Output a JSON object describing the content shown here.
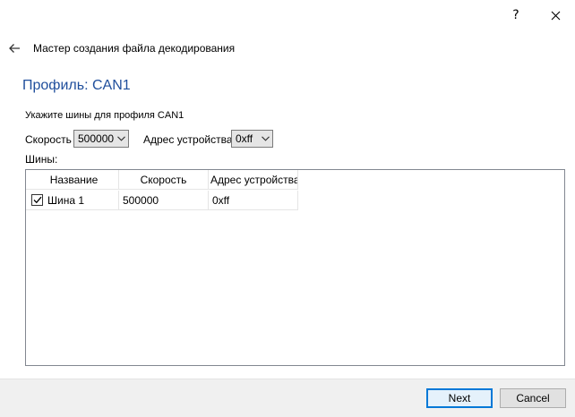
{
  "window": {
    "help_label": "?",
    "close_icon": "close-icon"
  },
  "header": {
    "back_icon": "back-arrow-icon",
    "title": "Мастер создания файла декодирования"
  },
  "page": {
    "title": "Профиль: CAN1",
    "instruction": "Укажите шины для профиля CAN1"
  },
  "form": {
    "speed_label": "Скорость",
    "speed_value": "500000",
    "address_label": "Адрес устройства",
    "address_value": "0xff",
    "buses_label": "Шины:"
  },
  "table": {
    "columns": [
      "Название",
      "Скорость",
      "Адрес устройства"
    ],
    "rows": [
      {
        "checked": true,
        "name": "Шина 1",
        "speed": "500000",
        "address": "0xff"
      }
    ]
  },
  "footer": {
    "next_label": "Next",
    "cancel_label": "Cancel"
  }
}
